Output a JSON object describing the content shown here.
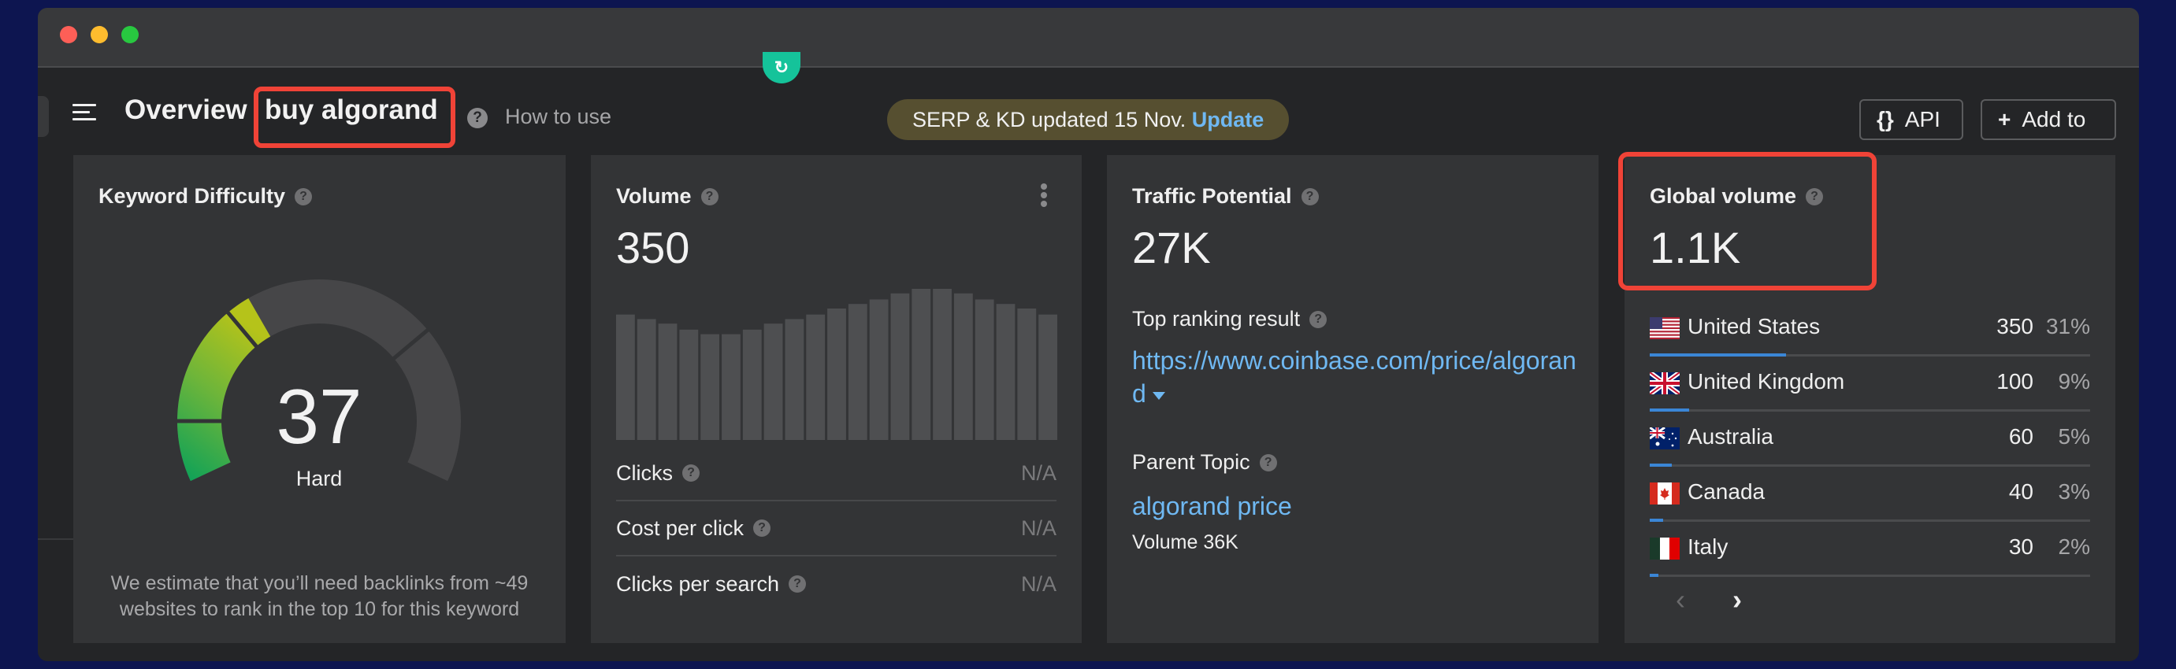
{
  "window": {
    "traffic_lights": [
      "close",
      "minimize",
      "zoom"
    ]
  },
  "header": {
    "menu_icon": "hamburger-menu-icon",
    "title": "Overview",
    "keyword": "buy algorand",
    "help_icon": "?",
    "how_to_use": "How to use",
    "notice_text": "SERP & KD updated 15 Nov.",
    "notice_link": "Update",
    "api_icon": "{}",
    "api_label": "API",
    "add_icon": "+",
    "add_label": "Add to"
  },
  "colors": {
    "accent_link": "#6fb8f2",
    "highlight_box": "#f04337",
    "progress_fill": "#3b86d6",
    "notice_bg": "#564f30"
  },
  "keyword_difficulty": {
    "title": "Keyword Difficulty",
    "value": 37,
    "value_label": "37",
    "max": 100,
    "rating": "Hard",
    "note": "We estimate that you’ll need backlinks from ~49 websites to rank in the top 10 for this keyword"
  },
  "volume": {
    "title": "Volume",
    "value": "350",
    "trend_relative": [
      0.83,
      0.8,
      0.77,
      0.73,
      0.7,
      0.7,
      0.73,
      0.77,
      0.8,
      0.83,
      0.87,
      0.9,
      0.93,
      0.97,
      1.0,
      1.0,
      0.97,
      0.93,
      0.9,
      0.87,
      0.83
    ],
    "metrics": [
      {
        "label": "Clicks",
        "value": "N/A"
      },
      {
        "label": "Cost per click",
        "value": "N/A"
      },
      {
        "label": "Clicks per search",
        "value": "N/A"
      }
    ]
  },
  "traffic_potential": {
    "title": "Traffic Potential",
    "value": "27K",
    "top_ranking_label": "Top ranking result",
    "top_ranking_url": "https://www.coinbase.com/price/algorand",
    "parent_topic_label": "Parent Topic",
    "parent_topic": "algorand price",
    "parent_volume": "Volume 36K"
  },
  "global_volume": {
    "title": "Global volume",
    "value": "1.1K",
    "countries": [
      {
        "name": "United States",
        "flag": "us",
        "count": "350",
        "pct": "31%",
        "share": 0.31
      },
      {
        "name": "United Kingdom",
        "flag": "gb",
        "count": "100",
        "pct": "9%",
        "share": 0.09
      },
      {
        "name": "Australia",
        "flag": "au",
        "count": "60",
        "pct": "5%",
        "share": 0.05
      },
      {
        "name": "Canada",
        "flag": "ca",
        "count": "40",
        "pct": "3%",
        "share": 0.03
      },
      {
        "name": "Italy",
        "flag": "it",
        "count": "30",
        "pct": "2%",
        "share": 0.02
      }
    ],
    "prev_icon": "‹",
    "next_icon": "›"
  }
}
